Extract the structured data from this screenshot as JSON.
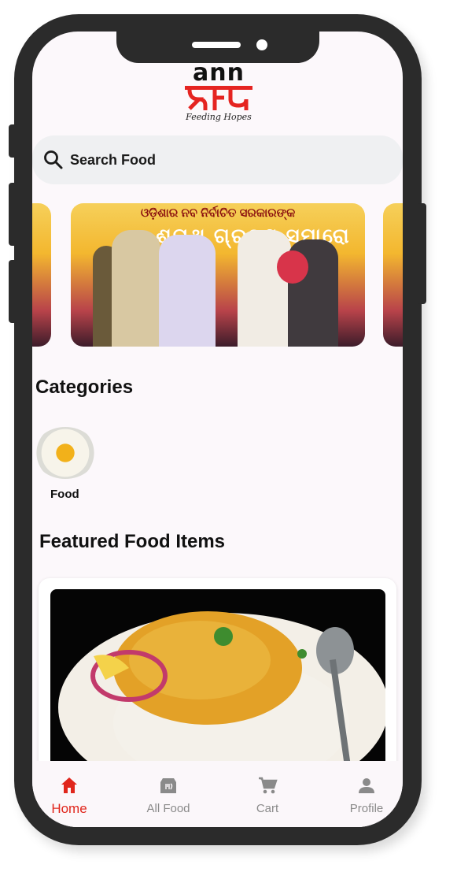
{
  "app": {
    "logo_top": "ann",
    "logo_bottom": "দান",
    "tagline": "Feeding Hopes"
  },
  "search": {
    "placeholder": "Search Food"
  },
  "banner": {
    "headline": "ଓଡ଼ିଶାର ନବ ନିର୍ବାଚିତ ସରକାରଙ୍କ",
    "subline": "ଶପଥ ଗ୍ରହଣ ସମାରୋ"
  },
  "categories": {
    "title": "Categories",
    "items": [
      {
        "label": "Food"
      }
    ]
  },
  "featured": {
    "title": "Featured Food Items"
  },
  "nav": {
    "items": [
      {
        "label": "Home",
        "icon": "home-icon",
        "active": true
      },
      {
        "label": "All Food",
        "icon": "food-bag-icon",
        "active": false
      },
      {
        "label": "Cart",
        "icon": "cart-icon",
        "active": false
      },
      {
        "label": "Profile",
        "icon": "person-icon",
        "active": false
      }
    ]
  },
  "colors": {
    "accent": "#e0261c",
    "phone_frame": "#2b2b2b",
    "nav_inactive": "#8a8a8a"
  }
}
